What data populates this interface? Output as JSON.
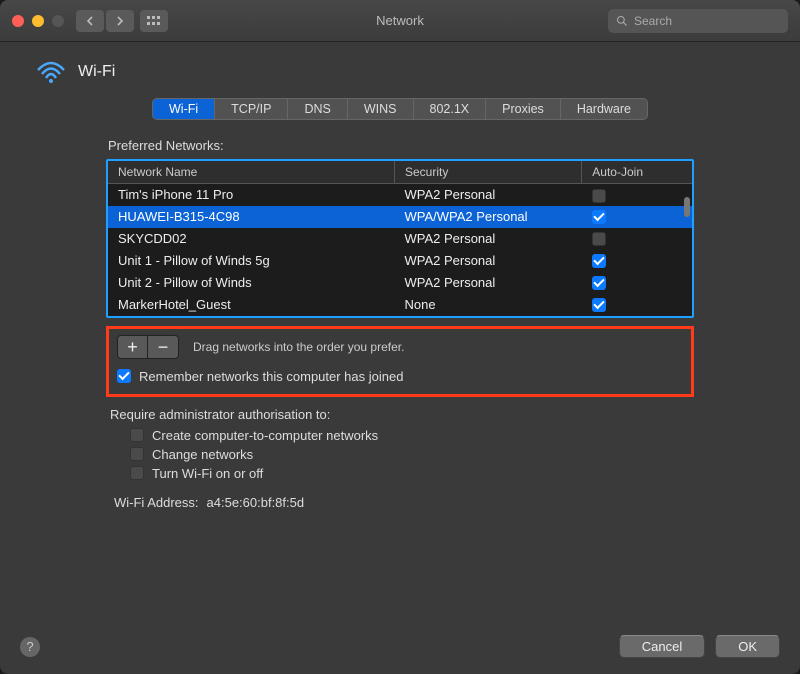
{
  "window": {
    "title": "Network",
    "search_placeholder": "Search"
  },
  "header": {
    "title": "Wi-Fi"
  },
  "tabs": [
    "Wi-Fi",
    "TCP/IP",
    "DNS",
    "WINS",
    "802.1X",
    "Proxies",
    "Hardware"
  ],
  "main": {
    "preferred_label": "Preferred Networks:",
    "columns": [
      "Network Name",
      "Security",
      "Auto-Join"
    ],
    "networks": [
      {
        "name": "Tim's iPhone 11 Pro",
        "security": "WPA2 Personal",
        "autojoin": false,
        "selected": false
      },
      {
        "name": "HUAWEI-B315-4C98",
        "security": "WPA/WPA2 Personal",
        "autojoin": true,
        "selected": true
      },
      {
        "name": "SKYCDD02",
        "security": "WPA2 Personal",
        "autojoin": false,
        "selected": false
      },
      {
        "name": "Unit 1 - Pillow of Winds 5g",
        "security": "WPA2 Personal",
        "autojoin": true,
        "selected": false
      },
      {
        "name": "Unit 2 - Pillow of Winds",
        "security": "WPA2 Personal",
        "autojoin": true,
        "selected": false
      },
      {
        "name": "MarkerHotel_Guest",
        "security": "None",
        "autojoin": true,
        "selected": false
      }
    ],
    "drag_hint": "Drag networks into the order you prefer.",
    "remember_label": "Remember networks this computer has joined",
    "admin_label": "Require administrator authorisation to:",
    "admin_opts": [
      "Create computer-to-computer networks",
      "Change networks",
      "Turn Wi-Fi on or off"
    ],
    "address_label": "Wi-Fi Address:",
    "address_value": "a4:5e:60:bf:8f:5d"
  },
  "footer": {
    "cancel": "Cancel",
    "ok": "OK"
  }
}
